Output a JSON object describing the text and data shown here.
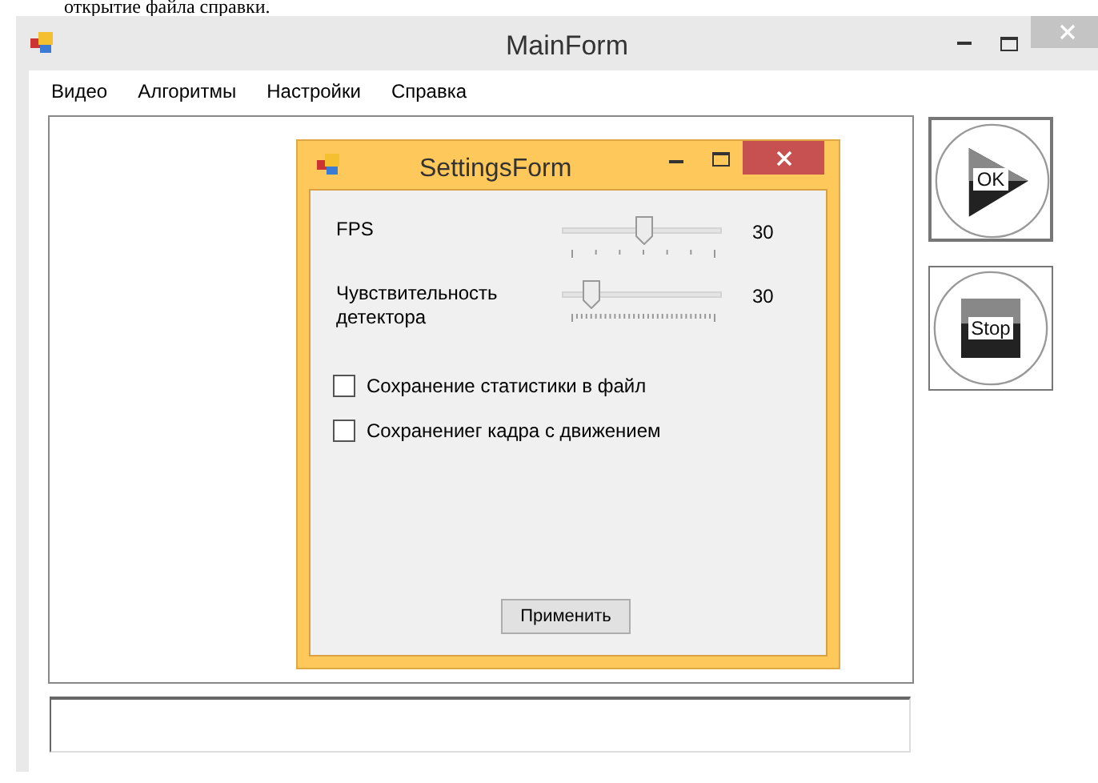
{
  "document_text": "открытие файла справки.",
  "main_window": {
    "title": "MainForm",
    "menu": [
      {
        "label": "Видео"
      },
      {
        "label": "Алгоритмы"
      },
      {
        "label": "Настройки"
      },
      {
        "label": "Справка"
      }
    ],
    "buttons": [
      {
        "label": "OK",
        "kind": "play"
      },
      {
        "label": "Stop",
        "kind": "stop"
      }
    ]
  },
  "settings_window": {
    "title": "SettingsForm",
    "sliders": [
      {
        "label": "FPS",
        "level": 0.5,
        "reading": "30"
      },
      {
        "label": "Чувствительность детектора",
        "level": 0.17,
        "reading": "30"
      }
    ],
    "checkboxes": [
      {
        "label": "Сохранение статистики в файл",
        "checked": false
      },
      {
        "label": "Сохранениег кадра с движением",
        "checked": false
      }
    ],
    "apply_button": "Применить"
  }
}
